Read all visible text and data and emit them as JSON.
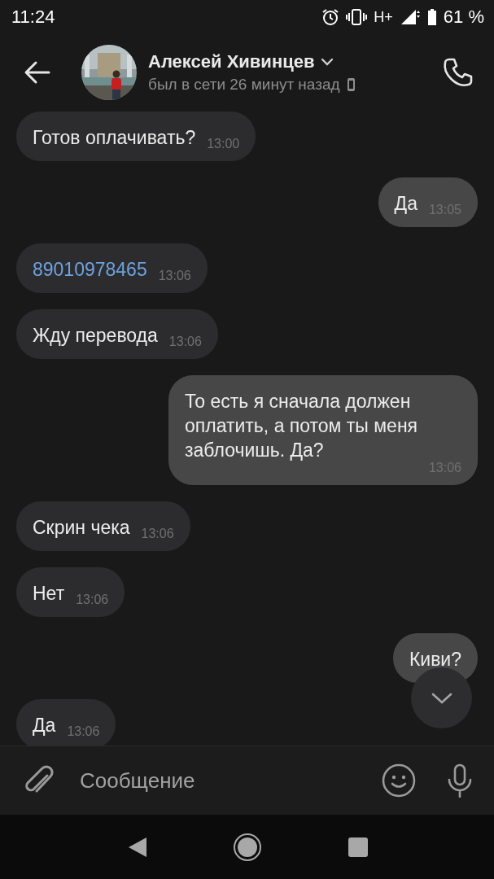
{
  "status_bar": {
    "time": "11:24",
    "network": "H+",
    "battery": "61 %"
  },
  "header": {
    "name": "Алексей Хивинцев",
    "status": "был в сети 26 минут назад"
  },
  "messages": [
    {
      "outgoing": false,
      "kind": "text",
      "text": "Готов оплачивать?",
      "time": "13:00"
    },
    {
      "outgoing": true,
      "kind": "text",
      "text": "Да",
      "time": "13:05"
    },
    {
      "outgoing": false,
      "kind": "link",
      "text": "89010978465",
      "time": "13:06"
    },
    {
      "outgoing": false,
      "kind": "text",
      "text": "Жду перевода",
      "time": "13:06"
    },
    {
      "outgoing": true,
      "kind": "text",
      "text": "То есть я сначала должен оплатить, а потом ты меня заблочишь. Да?",
      "time": "13:06"
    },
    {
      "outgoing": false,
      "kind": "text",
      "text": "Скрин чека",
      "time": "13:06"
    },
    {
      "outgoing": false,
      "kind": "text",
      "text": "Нет",
      "time": "13:06"
    },
    {
      "outgoing": true,
      "kind": "text",
      "text": "Киви?"
    },
    {
      "outgoing": false,
      "kind": "text",
      "text": "Да",
      "time": "13:06"
    }
  ],
  "composer": {
    "placeholder": "Сообщение"
  }
}
